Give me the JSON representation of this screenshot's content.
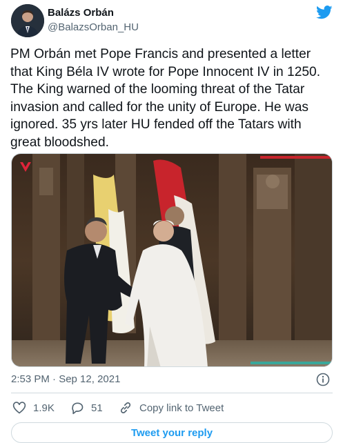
{
  "author": {
    "name": "Balázs Orbán",
    "handle": "@BalazsOrban_HU"
  },
  "tweet": {
    "text": "PM Orbán met Pope Francis and presented a letter\nthat King Béla IV wrote for Pope Innocent IV in 1250.\nThe King warned of the looming threat of the Tatar\ninvasion and called for the unity of Europe. He was\nignored. 35 yrs later HU fended off the Tatars with\ngreat bloodshed.",
    "timestamp": "2:53 PM · Sep 12, 2021"
  },
  "actions": {
    "likes": "1.9K",
    "replies": "51",
    "copy_link": "Copy link to Tweet"
  },
  "reply_button": "Tweet your reply",
  "colors": {
    "brand": "#1d9bf0",
    "text": "#0f1419",
    "muted": "#536471",
    "border": "#cfd9de"
  },
  "icons": [
    "twitter-bird-icon",
    "info-icon",
    "heart-icon",
    "reply-icon",
    "link-icon"
  ]
}
